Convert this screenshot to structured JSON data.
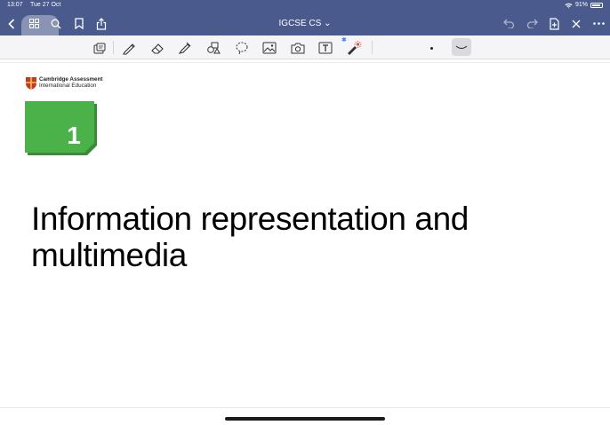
{
  "status_bar": {
    "time": "13:07",
    "date": "Tue 27 Oct",
    "battery": "91%"
  },
  "nav": {
    "title": "IGCSE CS",
    "title_chevron": "⌄"
  },
  "toolbar": {
    "tools": [
      "selection-icon",
      "pen-icon",
      "eraser-icon",
      "highlighter-icon",
      "shapes-icon",
      "lasso-icon",
      "image-icon",
      "camera-icon",
      "text-box-icon",
      "laser-pointer-icon"
    ],
    "bluetooth_mark": "✱"
  },
  "page": {
    "logo_line1": "Cambridge Assessment",
    "logo_line2": "International Education",
    "chapter_number": "1",
    "heading_line1": "Information representation and",
    "heading_line2": "multimedia"
  },
  "colors": {
    "nav_bg": "#4a5a8c",
    "chapter_green": "#4bb24a",
    "chapter_shadow": "#3c8b3a",
    "logo_red": "#c0392b"
  }
}
